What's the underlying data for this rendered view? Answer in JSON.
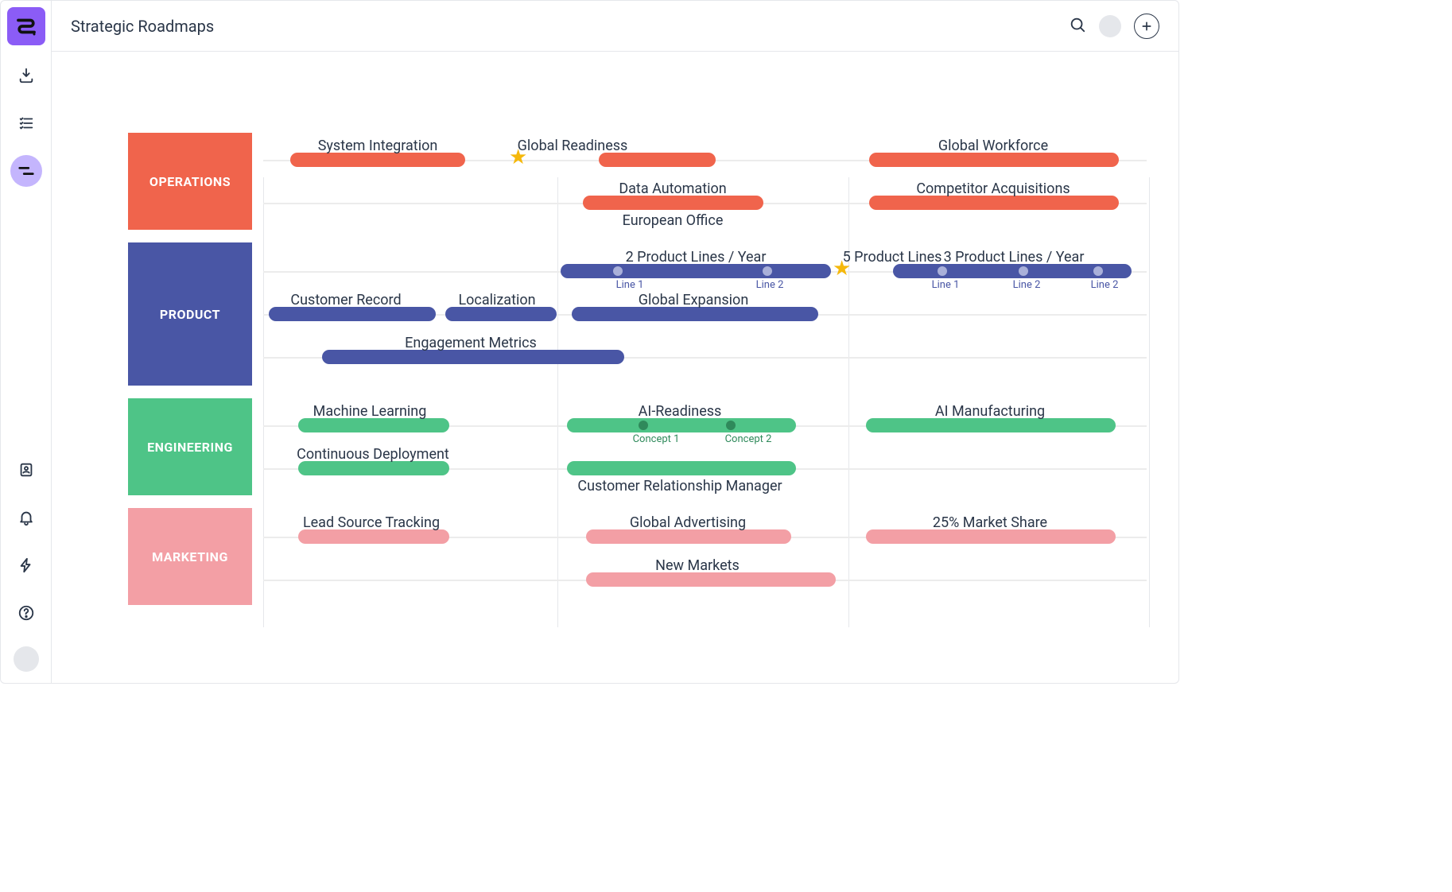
{
  "header": {
    "title": "Strategic Roadmaps"
  },
  "colors": {
    "operations": "#f0644c",
    "product": "#4956a5",
    "engineering": "#4ec487",
    "marketing": "#f39fa5",
    "product_sub": "#4956a5",
    "engineering_sub": "#2f8a5b"
  },
  "lanes": [
    {
      "id": "operations",
      "name": "OPERATIONS"
    },
    {
      "id": "product",
      "name": "PRODUCT"
    },
    {
      "id": "engineering",
      "name": "ENGINEERING"
    },
    {
      "id": "marketing",
      "name": "MARKETING"
    }
  ],
  "items": {
    "ops_sys_integration": "System Integration",
    "ops_global_readiness": "Global Readiness",
    "ops_global_workforce": "Global Workforce",
    "ops_data_automation": "Data Automation",
    "ops_competitor_acq": "Competitor Acquisitions",
    "ops_european_office": "European Office",
    "prod_2_lines": "2 Product Lines / Year",
    "prod_5_lines": "5 Product Lines",
    "prod_3_lines": "3 Product Lines / Year",
    "prod_line1a": "Line 1",
    "prod_line2a": "Line 2",
    "prod_line1b": "Line 1",
    "prod_line2b": "Line 2",
    "prod_line2c": "Line 2",
    "prod_customer_record": "Customer Record",
    "prod_localization": "Localization",
    "prod_global_expansion": "Global Expansion",
    "prod_engagement_metrics": "Engagement Metrics",
    "eng_ml": "Machine Learning",
    "eng_ai_readiness": "AI-Readiness",
    "eng_ai_manufacturing": "AI Manufacturing",
    "eng_concept1": "Concept 1",
    "eng_concept2": "Concept 2",
    "eng_cd": "Continuous Deployment",
    "eng_crm": "Customer Relationship Manager",
    "mkt_lead_source": "Lead Source Tracking",
    "mkt_global_adv": "Global Advertising",
    "mkt_25_share": "25% Market Share",
    "mkt_new_markets": "New Markets"
  }
}
